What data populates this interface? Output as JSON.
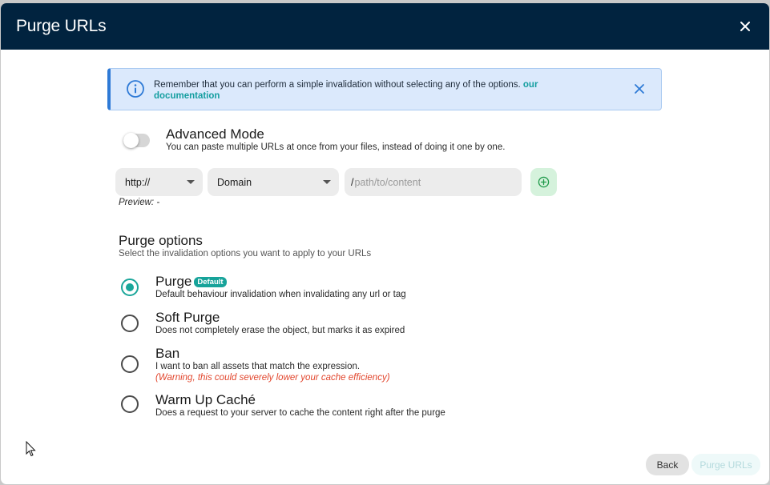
{
  "modal": {
    "title": "Purge URLs",
    "close_icon": "close-icon"
  },
  "alert": {
    "icon": "info-icon",
    "text": "Remember that you can perform a simple invalidation without selecting any of the options.",
    "link_text": "our documentation",
    "close_icon": "close-icon",
    "colors": {
      "background": "#dbe9fc",
      "accent": "#2e7ad6",
      "link": "#149ea0"
    }
  },
  "advanced_mode": {
    "title": "Advanced Mode",
    "description": "You can paste multiple URLs at once from your files, instead of doing it one by one.",
    "enabled": false
  },
  "url_builder": {
    "protocol": "http://",
    "domain": "Domain",
    "path_prefix": "/",
    "path_placeholder": "path/to/content",
    "add_icon": "plus-circle-icon",
    "preview_label": "Preview:",
    "preview_value": "-"
  },
  "purge_options": {
    "title": "Purge options",
    "description": "Select the invalidation options you want to apply to your URLs",
    "selected": "purge",
    "items": [
      {
        "id": "purge",
        "title": "Purge",
        "badge": "Default",
        "description": "Default behaviour invalidation when invalidating any url or tag"
      },
      {
        "id": "soft-purge",
        "title": "Soft Purge",
        "description": "Does not completely erase the object, but marks it as expired"
      },
      {
        "id": "ban",
        "title": "Ban",
        "description": "I want to ban all assets that match the expression.",
        "warning": "(Warning, this could severely lower your cache efficiency)"
      },
      {
        "id": "warm-up",
        "title": "Warm Up Caché",
        "description": "Does a request to your server to cache the content right after the purge"
      }
    ],
    "accent_color": "#1aa69a"
  },
  "footer": {
    "back_label": "Back",
    "submit_label": "Purge URLs"
  },
  "theme": {
    "header_bg": "#01233f",
    "warning_color": "#e2462d"
  }
}
